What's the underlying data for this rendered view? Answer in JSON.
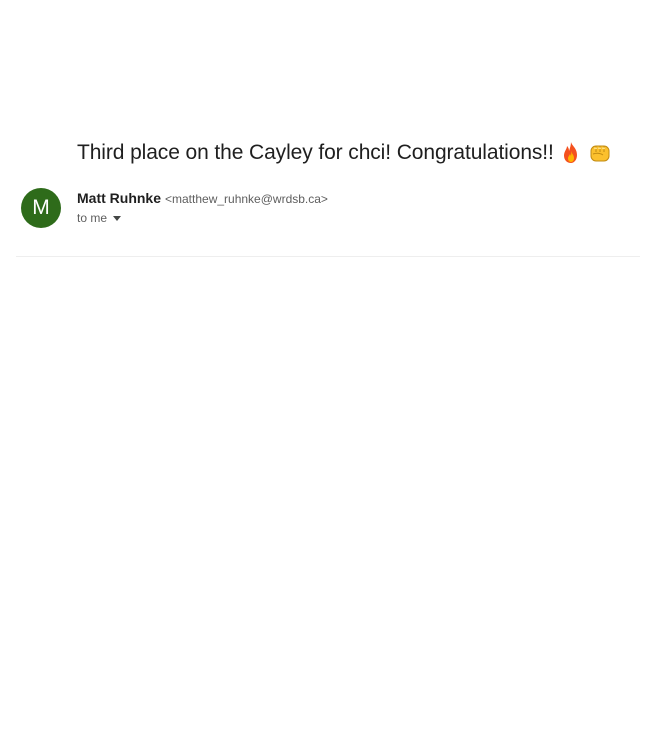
{
  "email": {
    "subject": "Third place on the Cayley for chci! Congratulations!!",
    "subject_emojis": [
      "fire-icon",
      "oncoming-fist-icon"
    ],
    "sender": {
      "avatar_letter": "M",
      "avatar_color": "#2e6b1a",
      "name": "Matt Ruhnke",
      "email": "<matthew_ruhnke@wrdsb.ca>"
    },
    "recipient_label": "to me"
  }
}
